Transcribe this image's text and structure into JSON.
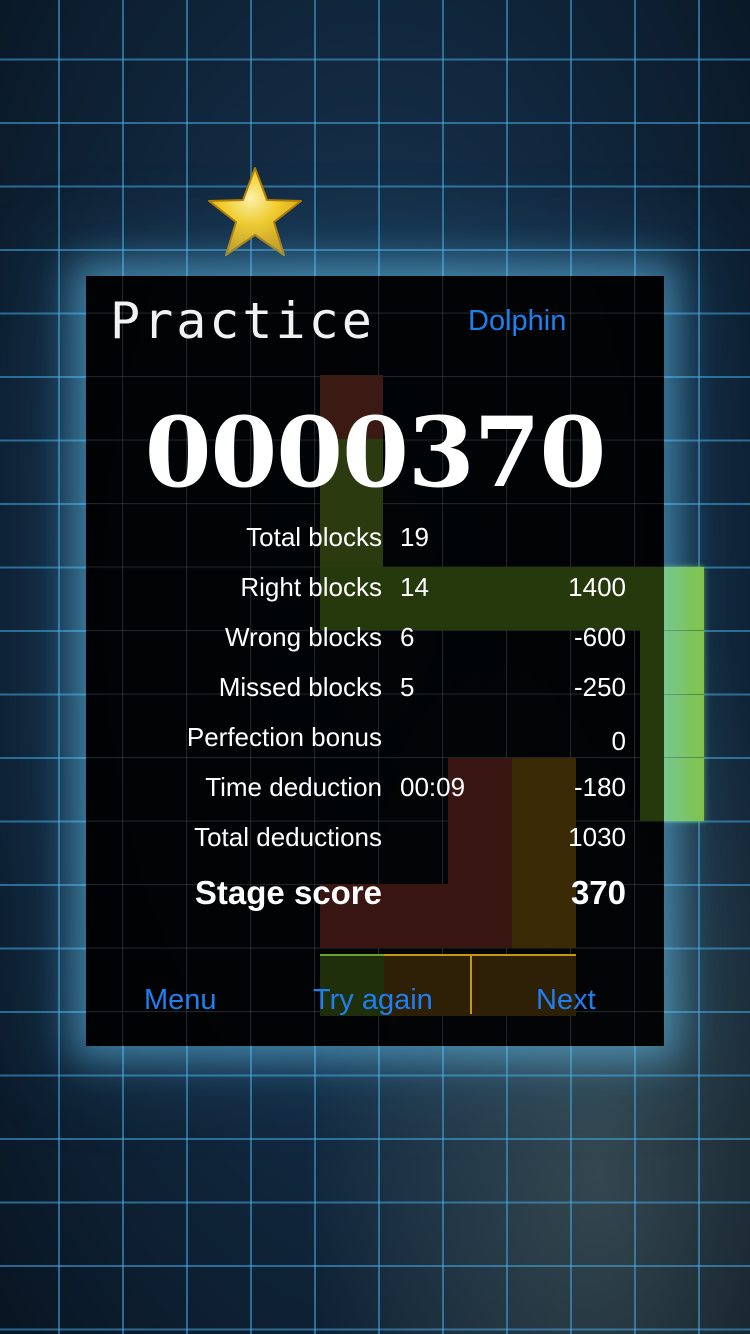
{
  "header": {
    "title": "Practice",
    "mode_label": "Dolphin"
  },
  "score": {
    "display": "0000370"
  },
  "stats": {
    "total_blocks": {
      "label": "Total blocks",
      "count": "19"
    },
    "right_blocks": {
      "label": "Right blocks",
      "count": "14",
      "points": "1400"
    },
    "wrong_blocks": {
      "label": "Wrong blocks",
      "count": "6",
      "points": "-600"
    },
    "missed_blocks": {
      "label": "Missed blocks",
      "count": "5",
      "points": "-250"
    },
    "perfection_bonus": {
      "label": "Perfection bonus",
      "points": "0"
    },
    "time_deduction": {
      "label": "Time deduction",
      "time": "00:09",
      "points": "-180"
    },
    "total_deductions": {
      "label": "Total deductions",
      "points": "1030"
    },
    "stage_score": {
      "label": "Stage score",
      "points": "370"
    }
  },
  "buttons": {
    "menu": "Menu",
    "try_again": "Try again",
    "next": "Next"
  },
  "colors": {
    "accent_blue": "#1f7ff0",
    "star_gold": "#f5c21a",
    "block_green": "#86c63c",
    "grid_blue": "#46aae6"
  }
}
